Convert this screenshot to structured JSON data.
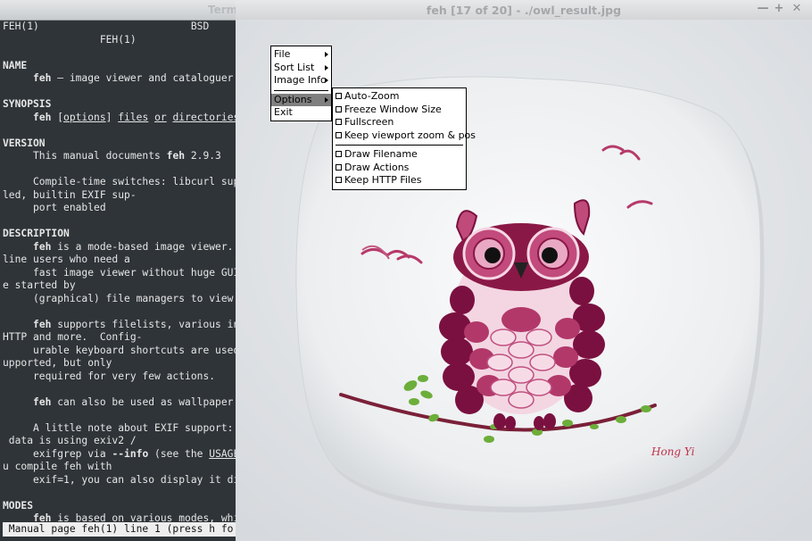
{
  "terminal": {
    "title": "Term",
    "lines": [
      {
        "segs": [
          {
            "t": "FEH(1)                         BSD",
            "c": ""
          }
        ]
      },
      {
        "segs": [
          {
            "t": "                FEH(1)",
            "c": ""
          }
        ]
      },
      {
        "segs": [
          {
            "t": "",
            "c": ""
          }
        ]
      },
      {
        "segs": [
          {
            "t": "NAME",
            "c": "b"
          }
        ]
      },
      {
        "segs": [
          {
            "t": "     ",
            "c": ""
          },
          {
            "t": "feh",
            "c": "b"
          },
          {
            "t": " – image viewer and cataloguer",
            "c": ""
          }
        ]
      },
      {
        "segs": [
          {
            "t": "",
            "c": ""
          }
        ]
      },
      {
        "segs": [
          {
            "t": "SYNOPSIS",
            "c": "b"
          }
        ]
      },
      {
        "segs": [
          {
            "t": "     ",
            "c": ""
          },
          {
            "t": "feh",
            "c": "b"
          },
          {
            "t": " [",
            "c": ""
          },
          {
            "t": "options",
            "c": "u"
          },
          {
            "t": "] ",
            "c": ""
          },
          {
            "t": "files",
            "c": "u"
          },
          {
            "t": " ",
            "c": ""
          },
          {
            "t": "or",
            "c": "u"
          },
          {
            "t": " ",
            "c": ""
          },
          {
            "t": "directories",
            "c": "u"
          }
        ]
      },
      {
        "segs": [
          {
            "t": "",
            "c": ""
          }
        ]
      },
      {
        "segs": [
          {
            "t": "VERSION",
            "c": "b"
          }
        ]
      },
      {
        "segs": [
          {
            "t": "     This manual documents ",
            "c": ""
          },
          {
            "t": "feh",
            "c": "b"
          },
          {
            "t": " 2.9.3",
            "c": ""
          }
        ]
      },
      {
        "segs": [
          {
            "t": "",
            "c": ""
          }
        ]
      },
      {
        "segs": [
          {
            "t": "     Compile-time switches: libcurl sup",
            "c": ""
          }
        ]
      },
      {
        "segs": [
          {
            "t": "led, builtin EXIF sup-",
            "c": ""
          }
        ]
      },
      {
        "segs": [
          {
            "t": "     port enabled",
            "c": ""
          }
        ]
      },
      {
        "segs": [
          {
            "t": "",
            "c": ""
          }
        ]
      },
      {
        "segs": [
          {
            "t": "DESCRIPTION",
            "c": "b"
          }
        ]
      },
      {
        "segs": [
          {
            "t": "     ",
            "c": ""
          },
          {
            "t": "feh",
            "c": "b"
          },
          {
            "t": " is a mode-based image viewer.",
            "c": ""
          }
        ]
      },
      {
        "segs": [
          {
            "t": "line users who need a",
            "c": ""
          }
        ]
      },
      {
        "segs": [
          {
            "t": "     fast image viewer without huge GUI",
            "c": ""
          }
        ]
      },
      {
        "segs": [
          {
            "t": "e started by",
            "c": ""
          }
        ]
      },
      {
        "segs": [
          {
            "t": "     (graphical) file managers to view",
            "c": ""
          }
        ]
      },
      {
        "segs": [
          {
            "t": "",
            "c": ""
          }
        ]
      },
      {
        "segs": [
          {
            "t": "     ",
            "c": ""
          },
          {
            "t": "feh",
            "c": "b"
          },
          {
            "t": " supports filelists, various in",
            "c": ""
          }
        ]
      },
      {
        "segs": [
          {
            "t": "HTTP and more.  Config-",
            "c": ""
          }
        ]
      },
      {
        "segs": [
          {
            "t": "     urable keyboard shortcuts are used",
            "c": ""
          }
        ]
      },
      {
        "segs": [
          {
            "t": "upported, but only",
            "c": ""
          }
        ]
      },
      {
        "segs": [
          {
            "t": "     required for very few actions.",
            "c": ""
          }
        ]
      },
      {
        "segs": [
          {
            "t": "",
            "c": ""
          }
        ]
      },
      {
        "segs": [
          {
            "t": "     ",
            "c": ""
          },
          {
            "t": "feh",
            "c": "b"
          },
          {
            "t": " can also be used as wallpaper",
            "c": ""
          }
        ]
      },
      {
        "segs": [
          {
            "t": "",
            "c": ""
          }
        ]
      },
      {
        "segs": [
          {
            "t": "     A little note about EXIF support:",
            "c": ""
          }
        ]
      },
      {
        "segs": [
          {
            "t": " data is using exiv2 /",
            "c": ""
          }
        ]
      },
      {
        "segs": [
          {
            "t": "     exifgrep via ",
            "c": ""
          },
          {
            "t": "--info",
            "c": "b"
          },
          {
            "t": " (see the ",
            "c": ""
          },
          {
            "t": "USAGE",
            "c": "u"
          }
        ]
      },
      {
        "segs": [
          {
            "t": "u compile feh with",
            "c": ""
          }
        ]
      },
      {
        "segs": [
          {
            "t": "     exif=1, you can also display it di",
            "c": ""
          }
        ]
      },
      {
        "segs": [
          {
            "t": "",
            "c": ""
          }
        ]
      },
      {
        "segs": [
          {
            "t": "MODES",
            "c": "b"
          }
        ]
      },
      {
        "segs": [
          {
            "t": "     ",
            "c": ""
          },
          {
            "t": "feh",
            "c": "b"
          },
          {
            "t": " is based on various modes, whi",
            "c": ""
          }
        ]
      }
    ],
    "status": " Manual page feh(1) line 1 (press h fo"
  },
  "feh": {
    "title": "feh [17 of 20] - ./owl_result.jpg",
    "window_buttons": {
      "minimize": "—",
      "maximize": "+",
      "close": "✕"
    },
    "image_signature": "Hong Yi",
    "menu": {
      "items": [
        "File",
        "Sort List",
        "Image Info",
        "Options",
        "Exit"
      ],
      "selected": "Options"
    },
    "options_menu": {
      "group1": [
        "Auto-Zoom",
        "Freeze Window Size",
        "Fullscreen",
        "Keep viewport zoom & pos"
      ],
      "group2": [
        "Draw Filename",
        "Draw Actions",
        "Keep HTTP Files"
      ]
    }
  },
  "colors": {
    "terminal_bg": "#2f3438",
    "photo_bg": "#e9eaec",
    "plate": "#f6f7f8",
    "onion_dark": "#7a1040",
    "onion_mid": "#b2386a",
    "onion_light": "#f2c7d8",
    "leaf": "#6cae3a"
  }
}
